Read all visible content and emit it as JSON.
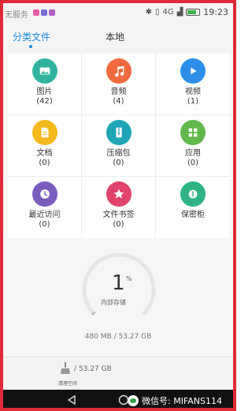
{
  "status_bar": {
    "carrier": "无服务",
    "time": "19:23",
    "signal_text": "4G",
    "notif_colors": [
      "#e85aa5",
      "#7b6dd8",
      "#b45cc7"
    ]
  },
  "tabs": [
    {
      "label": "分类文件",
      "active": true
    },
    {
      "label": "本地",
      "active": false
    }
  ],
  "categories": [
    {
      "label": "图片",
      "count": "(42)",
      "icon": "image-icon",
      "color": "#2fb39f"
    },
    {
      "label": "音频",
      "count": "(4)",
      "icon": "music-icon",
      "color": "#ef6a3f"
    },
    {
      "label": "视频",
      "count": "(1)",
      "icon": "play-icon",
      "color": "#2b8ee8"
    },
    {
      "label": "文档",
      "count": "(0)",
      "icon": "document-icon",
      "color": "#f3b91c"
    },
    {
      "label": "压缩包",
      "count": "(0)",
      "icon": "archive-icon",
      "color": "#1fa5b5"
    },
    {
      "label": "应用",
      "count": "(0)",
      "icon": "apps-icon",
      "color": "#62b84b"
    },
    {
      "label": "最近访问",
      "count": "(0)",
      "icon": "clock-icon",
      "color": "#7a5cbf"
    },
    {
      "label": "文件书签",
      "count": "(0)",
      "icon": "star-icon",
      "color": "#e0436b"
    },
    {
      "label": "保密柜",
      "count": "",
      "icon": "lock-icon",
      "color": "#2fb383"
    }
  ],
  "storage": {
    "percent": "1",
    "percent_sign": "%",
    "label": "内部存储",
    "usage": "480 MB / 53.27 GB",
    "fraction": 0.01
  },
  "cleanup": {
    "value": "/ 53.27 GB",
    "label": "清理空间"
  },
  "watermark": {
    "text": "微信号: MIFANS114"
  }
}
